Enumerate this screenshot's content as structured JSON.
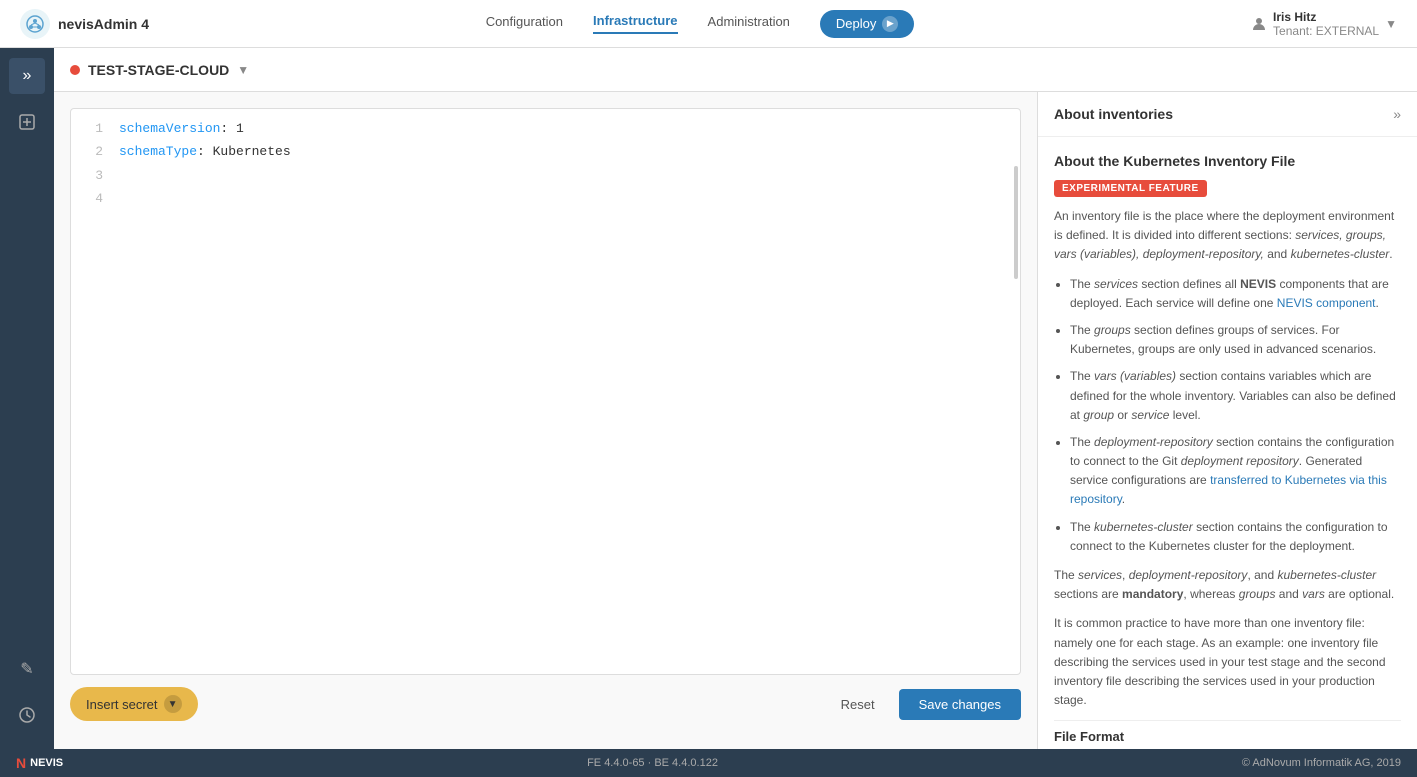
{
  "app": {
    "name": "nevisAdmin 4",
    "logo_letter": "N"
  },
  "nav": {
    "links": [
      {
        "id": "configuration",
        "label": "Configuration",
        "active": false
      },
      {
        "id": "infrastructure",
        "label": "Infrastructure",
        "active": true
      },
      {
        "id": "administration",
        "label": "Administration",
        "active": false
      }
    ],
    "deploy_label": "Deploy"
  },
  "user": {
    "name": "Iris Hitz",
    "tenant": "Tenant: EXTERNAL"
  },
  "sidebar": {
    "expand_icon": "»",
    "bottom_edit_icon": "✎",
    "bottom_history_icon": "⏱"
  },
  "inventory": {
    "name": "TEST-STAGE-CLOUD",
    "status_color": "#e74c3c"
  },
  "editor": {
    "lines": [
      {
        "number": "1",
        "content": "schemaVersion: 1"
      },
      {
        "number": "2",
        "content": "schemaType: Kubernetes"
      },
      {
        "number": "3",
        "content": ""
      },
      {
        "number": "4",
        "content": ""
      }
    ]
  },
  "footer": {
    "insert_secret_label": "Insert secret",
    "reset_label": "Reset",
    "save_label": "Save changes"
  },
  "help": {
    "title": "About inventories",
    "expand_icon": "»",
    "section_title": "About the Kubernetes Inventory File",
    "experimental_badge": "EXPERIMENTAL FEATURE",
    "paragraphs": [
      "An inventory file is the place where the deployment environment is defined. It is divided into different sections: services, groups, vars (variables), deployment-repository, and kubernetes-cluster.",
      "The services section defines all NEVIS components that are deployed. Each service will define one NEVIS component.",
      "The groups section defines groups of services. For Kubernetes, groups are only used in advanced scenarios.",
      "The vars (variables) section contains variables which are defined for the whole inventory. Variables can also be defined at group or service level.",
      "The deployment-repository section contains the configuration to connect to the Git deployment repository. Generated service configurations are transferred to Kubernetes via this repository.",
      "The kubernetes-cluster section contains the configuration to connect to the Kubernetes cluster for the deployment.",
      "The services, deployment-repository, and kubernetes-cluster sections are mandatory, whereas groups and vars are optional.",
      "It is common practice to have more than one inventory file: namely one for each stage. As an example: one inventory file describing the services used in your test stage and the second inventory file describing the services used in your production stage."
    ],
    "file_format_title": "File Format"
  },
  "bottombar": {
    "nevis_label": "NEVIS",
    "version": "FE 4.4.0-65 · BE 4.4.0.122",
    "copyright": "© AdNovum Informatik AG, 2019"
  }
}
